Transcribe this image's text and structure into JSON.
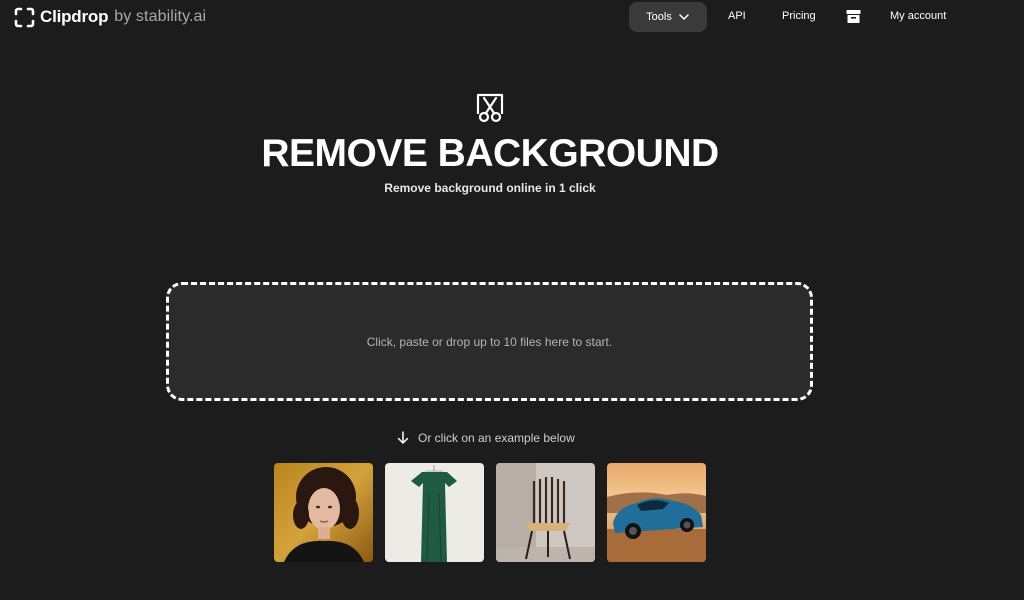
{
  "header": {
    "brand": "Clipdrop",
    "by_line": "by stability.ai",
    "logo_icon": "clipdrop-logo-icon",
    "nav": {
      "tools_label": "Tools",
      "api_label": "API",
      "pricing_label": "Pricing",
      "account_label": "My account",
      "archive_icon": "archive-box-icon"
    }
  },
  "hero": {
    "icon": "scissors-frame-icon",
    "title": "REMOVE BACKGROUND",
    "subtitle": "Remove background online in 1 click"
  },
  "dropzone": {
    "text": "Click, paste or drop up to 10 files here to start."
  },
  "examples": {
    "hint": "Or click on an example below",
    "items": [
      {
        "subject": "woman portrait"
      },
      {
        "subject": "green dress"
      },
      {
        "subject": "wooden chair"
      },
      {
        "subject": "blue sports car"
      }
    ]
  },
  "colors": {
    "background": "#1c1c1c",
    "dropzone_fill": "#2b2b2b",
    "tools_button": "#3a3a3a",
    "brand_text": "#ffffff",
    "muted_text": "#a8a8a8"
  }
}
